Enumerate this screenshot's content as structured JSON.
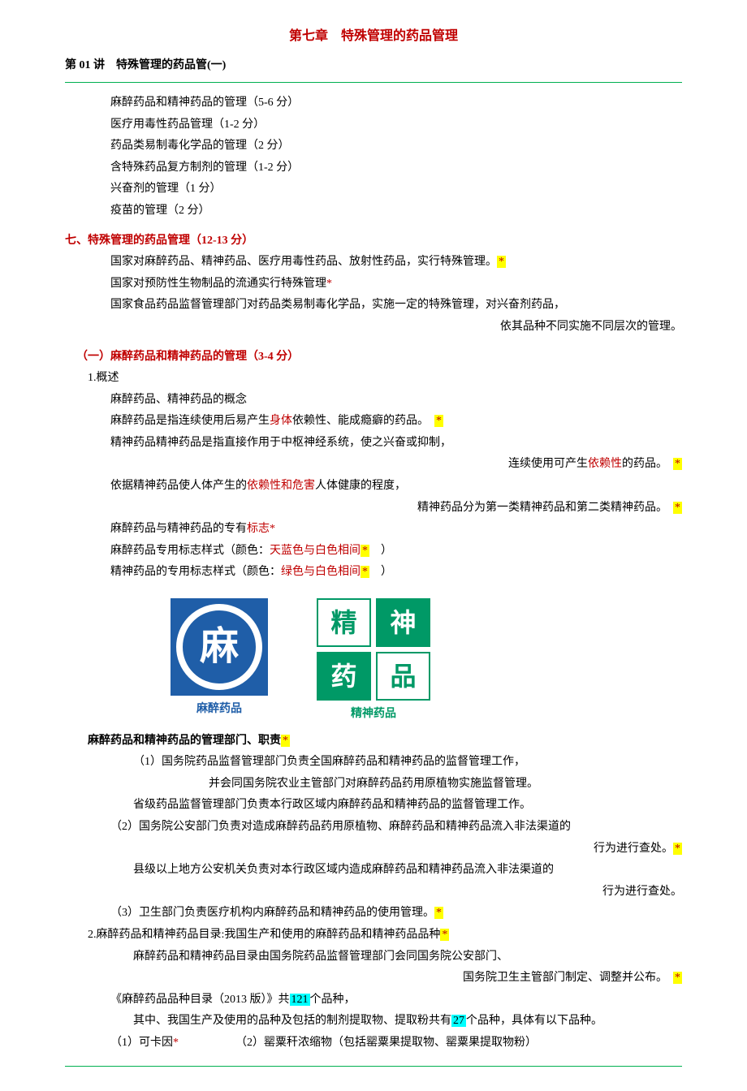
{
  "chapter_title": "第七章　特殊管理的药品管理",
  "lecture_title": "第 01 讲　特殊管理的药品管(一)",
  "intro_lines": [
    "麻醉药品和精神药品的管理（5-6 分）",
    "医疗用毒性药品管理（1-2 分）",
    "药品类易制毒化学品的管理（2 分）",
    "含特殊药品复方制剂的管理（1-2 分）",
    "兴奋剂的管理（1 分）",
    "疫苗的管理（2 分）"
  ],
  "section7": {
    "heading": "七、特殊管理的药品管理（12-13 分）",
    "lines": {
      "l1": "国家对麻醉药品、精神药品、医疗用毒性药品、放射性药品，实行特殊管理。",
      "l2a": "国家对预防性生物制品的流通实行特殊管理",
      "l3": "国家食品药品监督管理部门对药品类易制毒化学品，实施一定的特殊管理，对兴奋剂药品，",
      "l3r": "依其品种不同实施不同层次的管理。"
    }
  },
  "sub1": {
    "heading": "（一）麻醉药品和精神药品的管理（3-4 分）",
    "p1": "1.概述",
    "p2": "麻醉药品、精神药品的概念",
    "p3a": "麻醉药品是指连续使用后易产生",
    "p3b": "身体",
    "p3c": "依赖性、能成瘾癖的药品。　",
    "p4": "精神药品精神药品是指直接作用于中枢神经系统，使之兴奋或抑制，",
    "p4r_a": "连续使用可产生",
    "p4r_b": "依赖性",
    "p4r_c": "的药品。　",
    "p5a": "依据精神药品使人体产生的",
    "p5b": "依赖性和危害",
    "p5c": "人体健康的程度，",
    "p5r": "精神药品分为第一类精神药品和第二类精神药品。　",
    "p6a": "麻醉药品与精神药品的专有",
    "p6b": "标志",
    "p7a": "麻醉药品专用标志样式（颜色：",
    "p7b": "天蓝色与白色相间",
    "p7c": "　）",
    "p8a": "精神药品的专用标志样式（颜色：",
    "p8b": "绿色与白色相间",
    "p8c": "　）"
  },
  "logos": {
    "ma_char": "麻",
    "ma_label": "麻醉药品",
    "jing": [
      "精",
      "神",
      "药",
      "品"
    ],
    "jing_label": "精神药品"
  },
  "dept": {
    "heading_a": "麻醉药品和精神药品的管理部门、职责",
    "l1": "（1）国务院药品监督管理部门负责全国麻醉药品和精神药品的监督管理工作，",
    "l1r": "并会同国务院农业主管部门对麻醉药品药用原植物实施监督管理。",
    "l2": "省级药品监督管理部门负责本行政区域内麻醉药品和精神药品的监督管理工作。",
    "l3": "（2）国务院公安部门负责对造成麻醉药品药用原植物、麻醉药品和精神药品流入非法渠道的",
    "l3r": "行为进行查处。",
    "l4": "县级以上地方公安机关负责对本行政区域内造成麻醉药品和精神药品流入非法渠道的",
    "l4r": "行为进行查处。",
    "l5": "（3）卫生部门负责医疗机构内麻醉药品和精神药品的使用管理。",
    "cat_head": "2.麻醉药品和精神药品目录:我国生产和使用的麻醉药品和精神药品品种",
    "c1": "麻醉药品和精神药品目录由国务院药品监督管理部门会同国务院公安部门、",
    "c1r": "国务院卫生主管部门制定、调整并公布。　",
    "c2a": "《麻醉药品品种目录（2013 版）》共",
    "c2b": "121",
    "c2c": "个品种，",
    "c3a": "其中、我国生产及使用的品种及包括的制剂提取物、提取粉共有",
    "c3b": "27",
    "c3c": "个品种，具体有以下品种。",
    "c4a": "（1）可卡因",
    "c4b": "（2）罂粟秆浓缩物（包括罂粟果提取物、罂粟果提取物粉）"
  },
  "star": "*"
}
